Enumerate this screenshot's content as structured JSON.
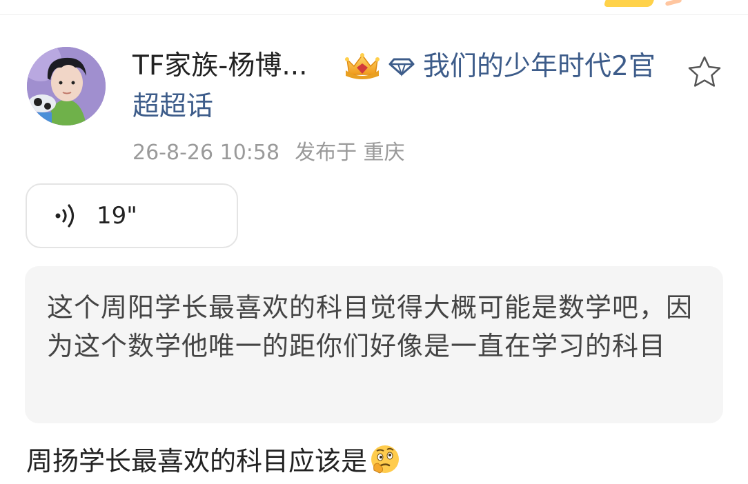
{
  "post": {
    "username": "TF家族-杨博...",
    "supertopic": "我们的少年时代2官超超话",
    "timestamp": "26-8-26 10:58",
    "location": "发布于 重庆",
    "voice": {
      "duration": "19\""
    },
    "quote": "这个周阳学长最喜欢的科目觉得大概可能是数学吧，因为这个数学他唯一的距你们好像是一直在学习的科目",
    "reply": "周扬学长最喜欢的科目应该是"
  },
  "icons": {
    "crown": "crown-badge-icon",
    "diamond": "diamond-icon",
    "star": "star-outline-icon",
    "voice": "sound-wave-icon",
    "emoji": "thinking-face-emoji"
  },
  "colors": {
    "link_blue": "#3d5c8a",
    "meta_gray": "#9a9a9a",
    "quote_bg": "#f5f5f5",
    "text": "#222222"
  }
}
